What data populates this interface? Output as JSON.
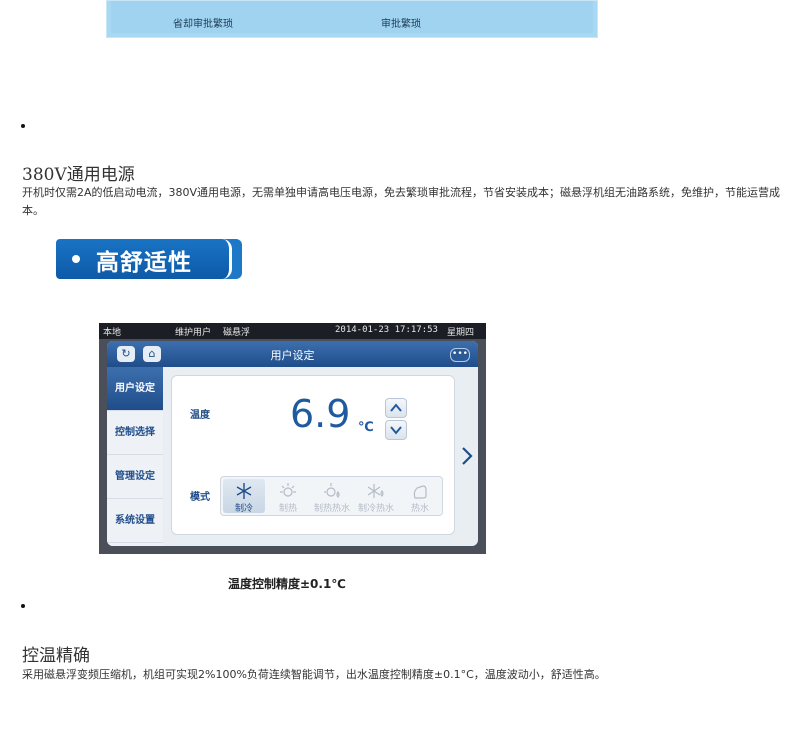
{
  "banner": {
    "caption_left": "省却审批繁琐",
    "caption_right": "审批繁琐"
  },
  "section1": {
    "title": "380V通用电源",
    "body": "开机时仅需2A的低启动电流，380V通用电源，无需单独申请高电压电源，免去繁琐审批流程，节省安装成本；磁悬浮机组无油路系统，免维护，节能运营成本。"
  },
  "ribbon": {
    "label": "高舒适性"
  },
  "device": {
    "status": {
      "location": "本地",
      "user": "维护用户",
      "system": "磁悬浮",
      "datetime": "2014-01-23 17:17:53",
      "weekday": "星期四"
    },
    "title": "用户设定",
    "refresh_icon": "↻",
    "home_icon": "⌂",
    "menu_icon": "•••",
    "sidebar": [
      {
        "label": "用户设定",
        "active": true
      },
      {
        "label": "控制选择",
        "active": false
      },
      {
        "label": "管理设定",
        "active": false
      },
      {
        "label": "系统设置",
        "active": false
      }
    ],
    "temperature": {
      "label": "温度",
      "value": "6.9",
      "unit": "℃"
    },
    "mode": {
      "label": "模式",
      "options": [
        {
          "label": "制冷",
          "icon": "snowflake-icon",
          "active": true
        },
        {
          "label": "制热",
          "icon": "sun-icon",
          "active": false
        },
        {
          "label": "制热热水",
          "icon": "sun-drop-icon",
          "active": false
        },
        {
          "label": "制冷热水",
          "icon": "snowflake-drop-icon",
          "active": false
        },
        {
          "label": "热水",
          "icon": "hand-water-icon",
          "active": false
        }
      ]
    },
    "colors": {
      "accent": "#1f4d8a",
      "value": "#1f5aa0"
    }
  },
  "caption": "温度控制精度±0.1℃",
  "section2": {
    "title": "控温精确",
    "body": "采用磁悬浮变频压缩机，机组可实现2%100%负荷连续智能调节，出水温度控制精度±0.1°C，温度波动小，舒适性高。"
  }
}
